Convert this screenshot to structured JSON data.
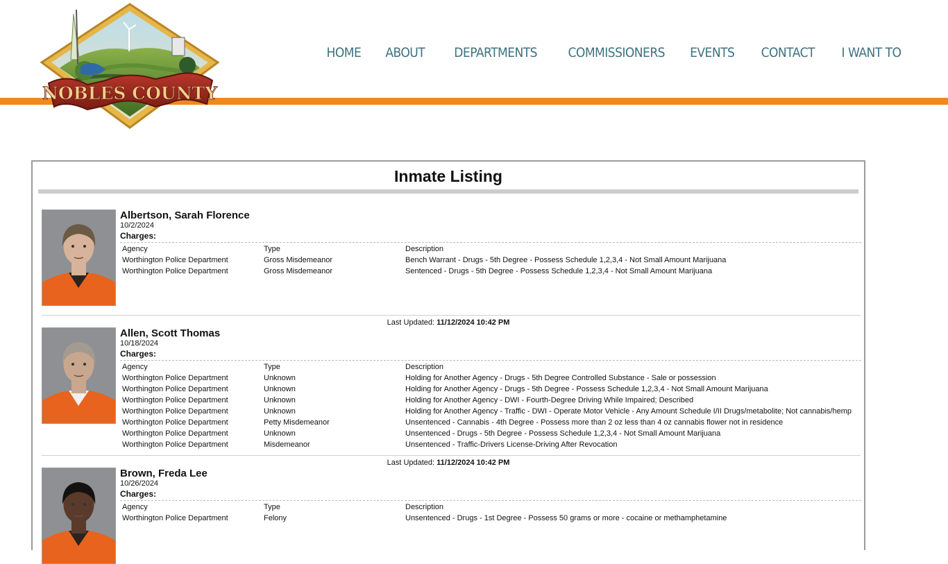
{
  "site": {
    "logo_text": "NOBLES COUNTY",
    "nav": [
      "HOME",
      "ABOUT",
      "DEPARTMENTS",
      "COMMISSIONERS",
      "EVENTS",
      "CONTACT",
      "I WANT TO"
    ],
    "colors": {
      "nav": "#3d7280",
      "accent": "#ee8a1f",
      "ribbon": "#9c2a1e"
    }
  },
  "listing": {
    "title": "Inmate Listing",
    "charges_label": "Charges:",
    "headers": {
      "agency": "Agency",
      "type": "Type",
      "description": "Description"
    },
    "updated_label": "Last Updated:",
    "updated_value": "11/12/2024 10:42 PM",
    "inmates": [
      {
        "name": "Albertson, Sarah Florence",
        "date": "10/2/2024",
        "photo": {
          "hair": "#6b5a44",
          "skin": "#d6b39a",
          "shirt": "#e8641e",
          "under": "#2a2420"
        },
        "charges": [
          {
            "agency": "Worthington Police Department",
            "type": "Gross Misdemeanor",
            "description": "Bench Warrant - Drugs - 5th Degree - Possess Schedule 1,2,3,4 - Not Small Amount Marijuana"
          },
          {
            "agency": "Worthington Police Department",
            "type": "Gross Misdemeanor",
            "description": "Sentenced - Drugs - 5th Degree - Possess Schedule 1,2,3,4 - Not Small Amount Marijuana"
          }
        ]
      },
      {
        "name": "Allen, Scott Thomas",
        "date": "10/18/2024",
        "photo": {
          "hair": "#a39a90",
          "skin": "#c9a78f",
          "shirt": "#e8641e",
          "under": "#efefef"
        },
        "charges": [
          {
            "agency": "Worthington Police Department",
            "type": "Unknown",
            "description": "Holding for Another Agency - Drugs - 5th Degree Controlled Substance - Sale or possession"
          },
          {
            "agency": "Worthington Police Department",
            "type": "Unknown",
            "description": "Holding for Another Agency - Drugs - 5th Degree - Possess Schedule 1,2,3,4 - Not Small Amount Marijuana"
          },
          {
            "agency": "Worthington Police Department",
            "type": "Unknown",
            "description": "Holding for Another Agency - DWI - Fourth-Degree Driving While Impaired; Described"
          },
          {
            "agency": "Worthington Police Department",
            "type": "Unknown",
            "description": "Holding for Another Agency - Traffic - DWI - Operate Motor Vehicle - Any Amount Schedule I/II Drugs/metabolite; Not cannabis/hemp"
          },
          {
            "agency": "Worthington Police Department",
            "type": "Petty Misdemeanor",
            "description": "Unsentenced - Cannabis - 4th Degree - Possess more than 2 oz less than 4 oz cannabis flower not in residence"
          },
          {
            "agency": "Worthington Police Department",
            "type": "Unknown",
            "description": "Unsentenced - Drugs - 5th Degree - Possess Schedule 1,2,3,4 - Not Small Amount Marijuana"
          },
          {
            "agency": "Worthington Police Department",
            "type": "Misdemeanor",
            "description": "Unsentenced - Traffic-Drivers License-Driving After Revocation"
          }
        ]
      },
      {
        "name": "Brown, Freda Lee",
        "date": "10/26/2024",
        "photo": {
          "hair": "#141210",
          "skin": "#5a3a2a",
          "shirt": "#e8641e",
          "under": "#2a2420"
        },
        "charges": [
          {
            "agency": "Worthington Police Department",
            "type": "Felony",
            "description": "Unsentenced - Drugs - 1st Degree - Possess 50 grams or more - cocaine or methamphetamine"
          }
        ]
      }
    ]
  }
}
